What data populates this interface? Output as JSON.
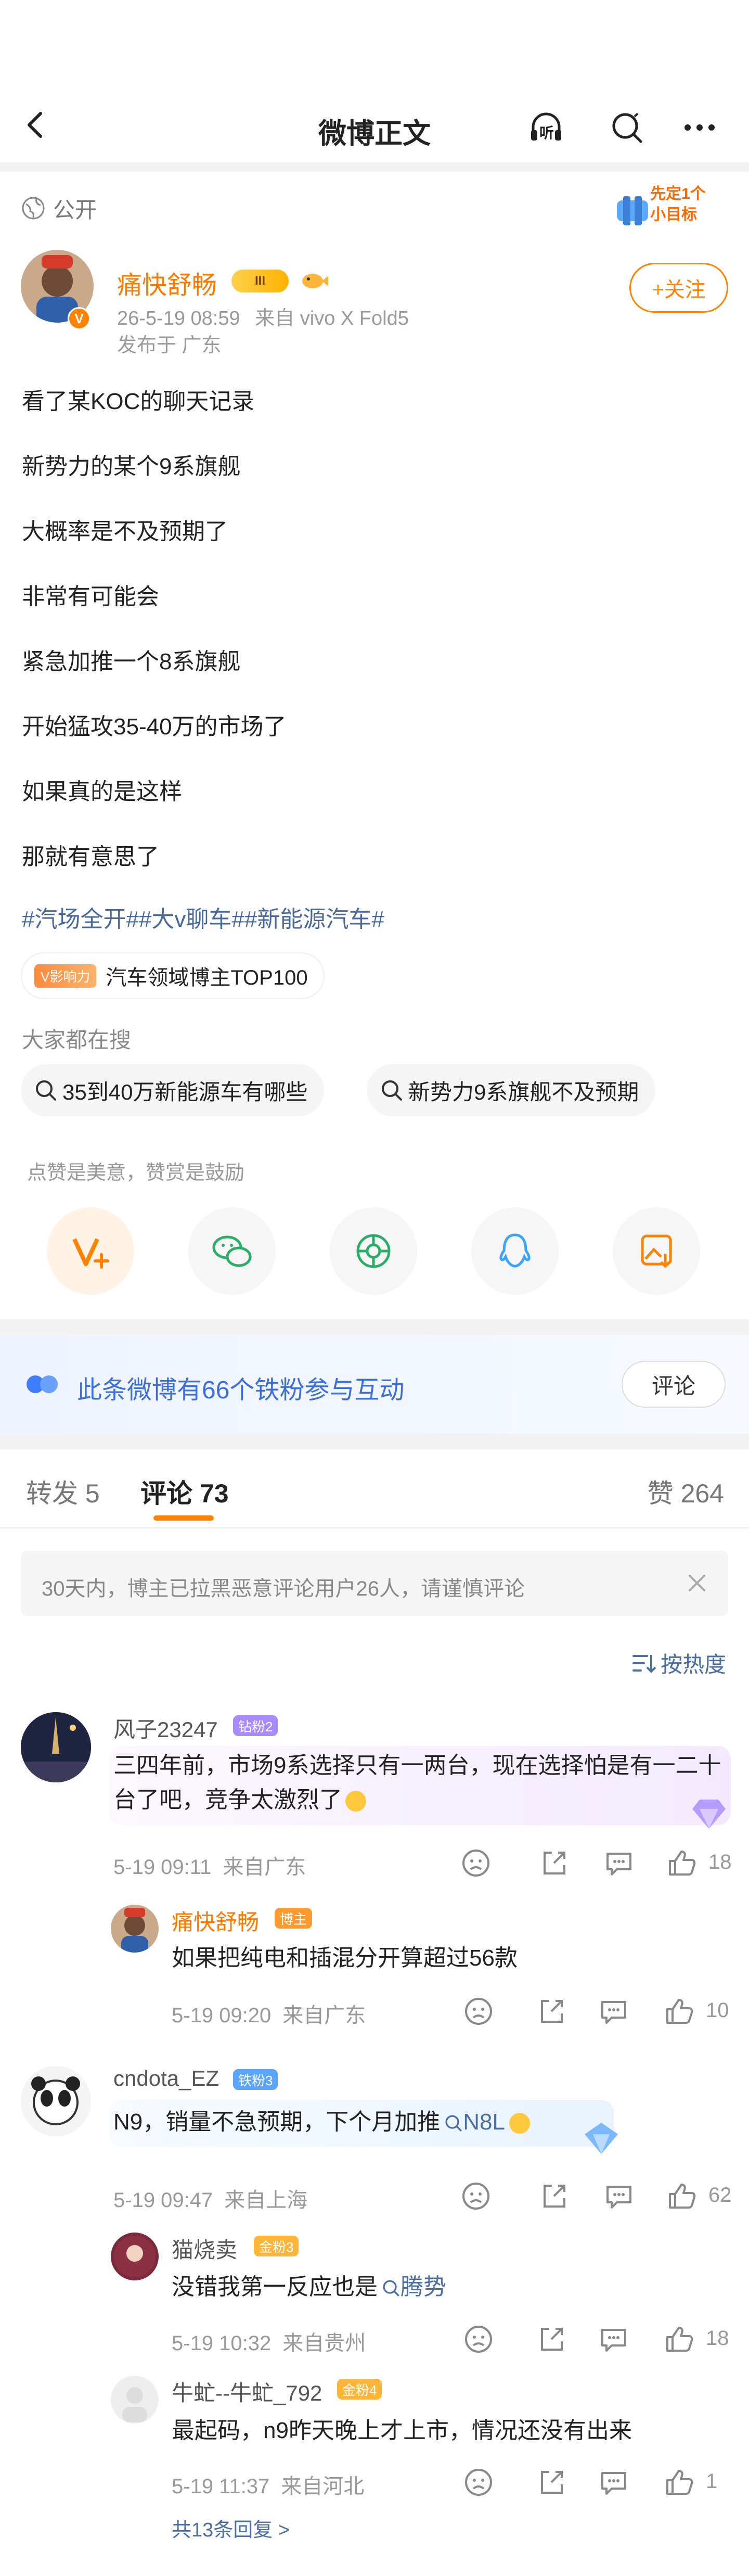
{
  "nav": {
    "title": "微博正文",
    "listen_label": "听"
  },
  "post": {
    "visibility": "公开",
    "goal_badge": "先定1个小目标",
    "author": "痛快舒畅",
    "level_badge": "III",
    "time": "26-5-19 08:59",
    "source": "来自 vivo X Fold5",
    "location": "发布于 广东",
    "follow_label": "+关注",
    "lines": [
      "看了某KOC的聊天记录",
      "新势力的某个9系旗舰",
      "大概率是不及预期了",
      "非常有可能会",
      "紧急加推一个8系旗舰",
      "开始猛攻35-40万的市场了",
      "如果真的是这样",
      "那就有意思了"
    ],
    "topics": "#汽场全开##大v聊车##新能源汽车#",
    "influence_badge": "V影响力",
    "influence_text": "汽车领域博主TOP100"
  },
  "search": {
    "label": "大家都在搜",
    "items": [
      "35到40万新能源车有哪些",
      "新势力9系旗舰不及预期"
    ]
  },
  "share": {
    "hint": "点赞是美意，赞赏是鼓励",
    "items": [
      "v-plus-icon",
      "wechat-icon",
      "moments-icon",
      "qq-icon",
      "save-image-icon"
    ]
  },
  "iron_fans": {
    "text": "此条微博有66个铁粉参与互动",
    "button": "评论"
  },
  "tabs": {
    "repost": "转发 5",
    "comment": "评论 73",
    "like": "赞 264"
  },
  "notice": "30天内，博主已拉黑恶意评论用户26人，请谨慎评论",
  "sort_label": "按热度",
  "comments": [
    {
      "name": "风子23247",
      "badge": "钻粉2",
      "text": "三四年前，市场9系选择只有一两台，现在选择怕是有一二十台了吧，竞争太激烈了",
      "time": "5-19 09:11",
      "loc": "来自广东",
      "likes": "18"
    },
    {
      "name": "痛快舒畅",
      "badge": "博主",
      "text": "如果把纯电和插混分开算超过56款",
      "time": "5-19 09:20",
      "loc": "来自广东",
      "likes": "10"
    },
    {
      "name": "cndota_EZ",
      "badge": "铁粉3",
      "text": "N9，销量不急预期，下个月加推",
      "link": "N8L",
      "time": "5-19 09:47",
      "loc": "来自上海",
      "likes": "62"
    },
    {
      "name": "猫烧卖",
      "badge": "金粉3",
      "text": "没错我第一反应也是",
      "link": "腾势",
      "time": "5-19 10:32",
      "loc": "来自贵州",
      "likes": "18"
    },
    {
      "name": "牛虻--牛虻_792",
      "badge": "金粉4",
      "text": "最起码，n9昨天晚上才上市，情况还没有出来",
      "time": "5-19 11:37",
      "loc": "来自河北",
      "likes": "1"
    }
  ],
  "replies_more": "共13条回复 >"
}
